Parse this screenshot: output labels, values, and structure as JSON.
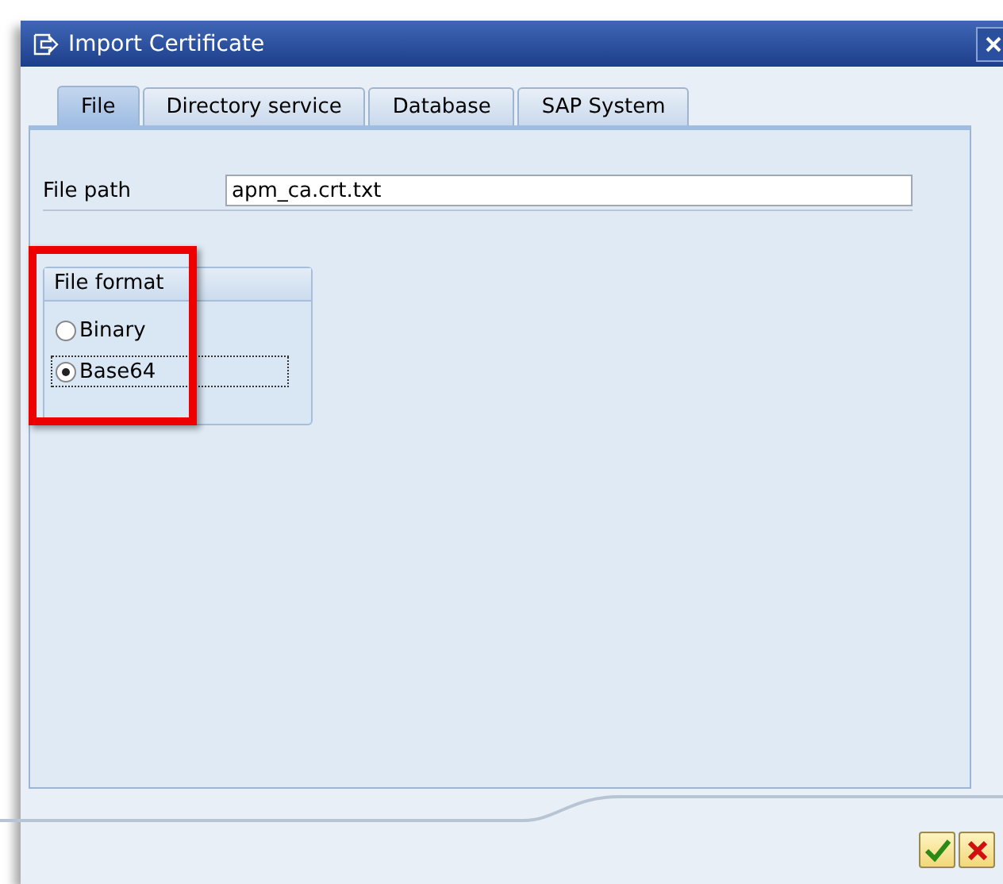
{
  "window": {
    "title": "Import Certificate"
  },
  "tabs": [
    {
      "label": "File",
      "selected": true
    },
    {
      "label": "Directory service",
      "selected": false
    },
    {
      "label": "Database",
      "selected": false
    },
    {
      "label": "SAP System",
      "selected": false
    }
  ],
  "file_path": {
    "label": "File path",
    "value": "apm_ca.crt.txt"
  },
  "file_format": {
    "title": "File format",
    "highlighted": true,
    "options": [
      {
        "label": "Binary",
        "selected": false
      },
      {
        "label": "Base64",
        "selected": true
      }
    ]
  }
}
